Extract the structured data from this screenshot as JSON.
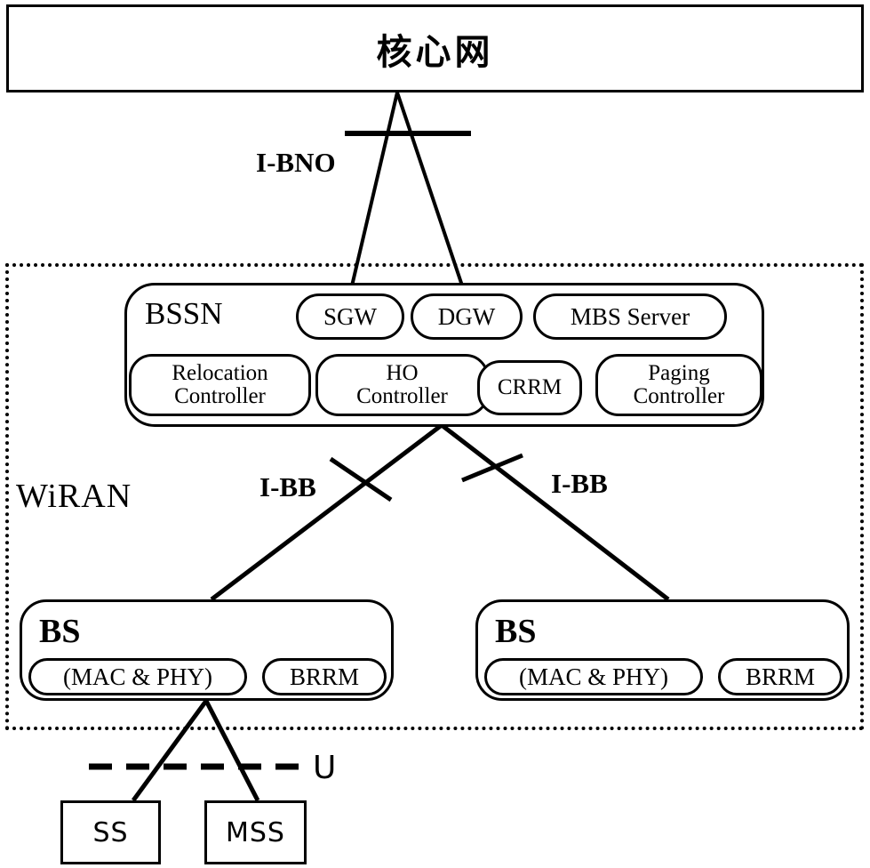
{
  "diagram": {
    "title_core_network": "核心网",
    "interfaces": {
      "i_bno": "I-BNO",
      "i_bb_left": "I-BB",
      "i_bb_right": "I-BB",
      "u": "U"
    },
    "wiran": {
      "label": "WiRAN",
      "bssn": {
        "label": "BSSN",
        "top_row": [
          {
            "label": "SGW"
          },
          {
            "label": "DGW"
          },
          {
            "label": "MBS Server"
          }
        ],
        "bottom_row": [
          {
            "line1": "Relocation",
            "line2": "Controller"
          },
          {
            "line1": "HO",
            "line2": "Controller"
          },
          {
            "line1": "CRRM",
            "line2": ""
          },
          {
            "line1": "Paging",
            "line2": "Controller"
          }
        ]
      },
      "base_stations": [
        {
          "label": "BS",
          "mac_phy": "(MAC & PHY)",
          "brrm": "BRRM"
        },
        {
          "label": "BS",
          "mac_phy": "(MAC & PHY)",
          "brrm": "BRRM"
        }
      ]
    },
    "terminals": [
      {
        "label": "SS"
      },
      {
        "label": "MSS"
      }
    ],
    "colors": {
      "stroke": "#000000",
      "background": "#ffffff"
    }
  }
}
